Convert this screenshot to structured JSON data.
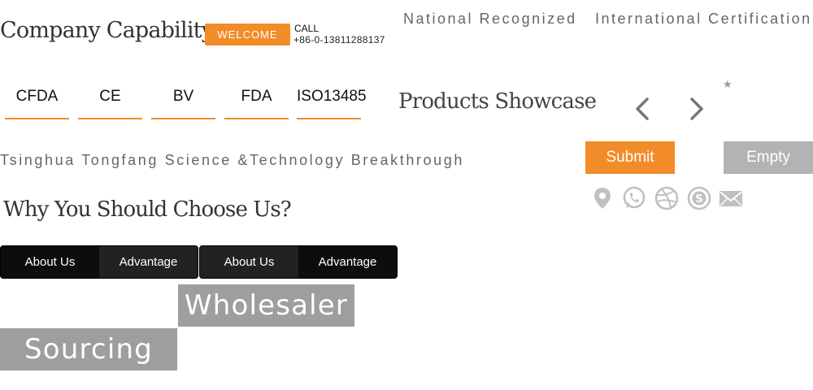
{
  "header": {
    "company_title": "Company Capability",
    "welcome": "WELCOME",
    "call_label": "CALL",
    "call_number": "+86-0-13811288137",
    "tagline_national": "National Recognized",
    "tagline_international": "International Certification"
  },
  "certifications": [
    "CFDA",
    "CE",
    "BV",
    "FDA",
    "ISO13485"
  ],
  "products": {
    "title": "Products Showcase",
    "prev_icon": "chevron-left-icon",
    "next_icon": "chevron-right-icon",
    "star": "★"
  },
  "tsinghua": "Tsinghua Tongfang Science &Technology Breakthrough",
  "form": {
    "submit": "Submit",
    "empty": "Empty"
  },
  "social_icons": [
    "location-icon",
    "whatsapp-icon",
    "dribbble-icon",
    "skype-icon",
    "mail-icon"
  ],
  "why": {
    "title": "Why You Should Choose Us?"
  },
  "tabs": [
    {
      "about": "About Us",
      "advantage": "Advantage"
    },
    {
      "about": "About Us",
      "advantage": "Advantage"
    }
  ],
  "tags": {
    "wholesaler": "Wholesaler",
    "sourcing": "Sourcing"
  },
  "colors": {
    "accent": "#f28c28",
    "gray_tag": "#9e9e9e",
    "empty_btn": "#b3b3b3",
    "icon_gray": "#c0c0c0"
  }
}
